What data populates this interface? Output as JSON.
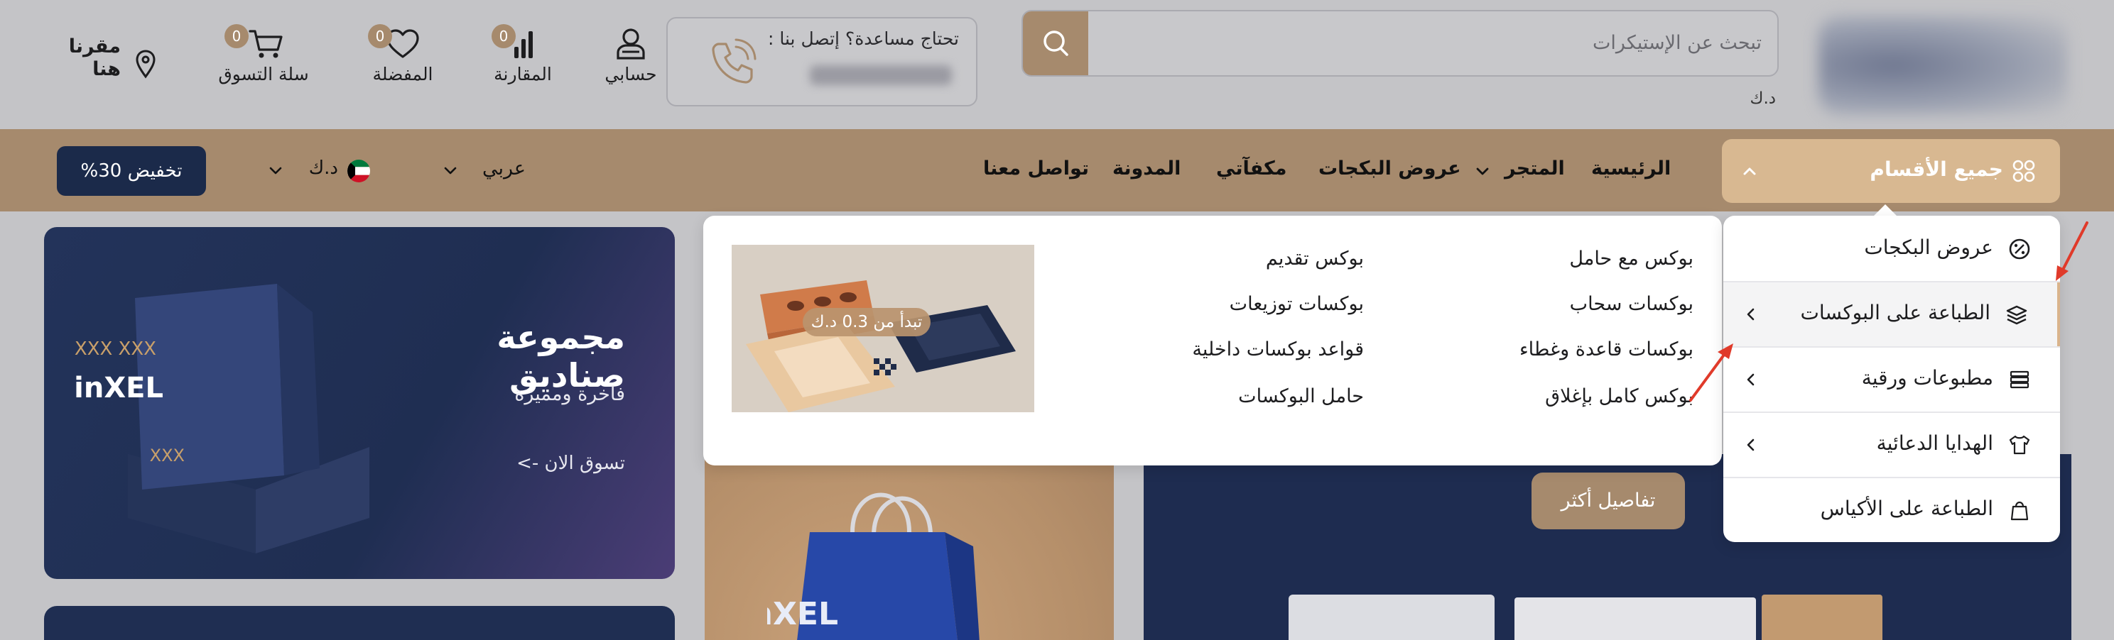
{
  "header": {
    "search": {
      "placeholder": "تبحث عن الإستيكرات"
    },
    "currency_sub": "د.ك",
    "help": {
      "title": "تحتاج مساعدة؟ إتصل بنا :"
    },
    "account": {
      "label": "حسابي"
    },
    "compare": {
      "label": "المقارنة",
      "count": "0"
    },
    "favorites": {
      "label": "المفضلة",
      "count": "0"
    },
    "cart": {
      "label": "سلة التسوق",
      "count": "0"
    },
    "location": {
      "line1": "مقرنا",
      "line2": "هنا"
    }
  },
  "nav": {
    "all_categories": "جميع الأقسام",
    "items": [
      "الرئيسية",
      "المتجر",
      "عروض البكجات",
      "مكفآتي",
      "المدونة",
      "تواصل معنا"
    ],
    "language": "عربي",
    "currency": "د.ك",
    "discount": "تخفيض 30%"
  },
  "categories": [
    {
      "label": "عروض البكجات",
      "icon": "badge-percent-icon",
      "has_sub": false
    },
    {
      "label": "الطباعة على البوكسات",
      "icon": "box-stack-icon",
      "has_sub": true,
      "active": true
    },
    {
      "label": "مطبوعات ورقية",
      "icon": "paper-stack-icon",
      "has_sub": true
    },
    {
      "label": "الهدايا الدعائية",
      "icon": "tshirt-icon",
      "has_sub": true
    },
    {
      "label": "الطباعة على الأكياس",
      "icon": "bag-icon",
      "has_sub": false
    }
  ],
  "mega_menu": {
    "column1": [
      "بوكس مع حامل",
      "بوكسات سحاب",
      "بوكسات قاعدة وغطاء",
      "بوكس كامل بإغلاق"
    ],
    "column2": [
      "بوكس تقديم",
      "بوكسات توزيعات",
      "قواعد بوكسات داخلية",
      "حامل البوكسات"
    ],
    "image_tag": "تبدأ من 0.3 د.ك"
  },
  "banners": {
    "main": {
      "title": "مجموعة صناديق",
      "subtitle": "فاخرة ومميزة",
      "cta": "تسوق الان ->"
    },
    "details_button": "تفاصيل أكثر"
  },
  "colors": {
    "brand": "#a68a6d",
    "navy": "#1b2a4a",
    "arrow": "#e03a2a"
  }
}
